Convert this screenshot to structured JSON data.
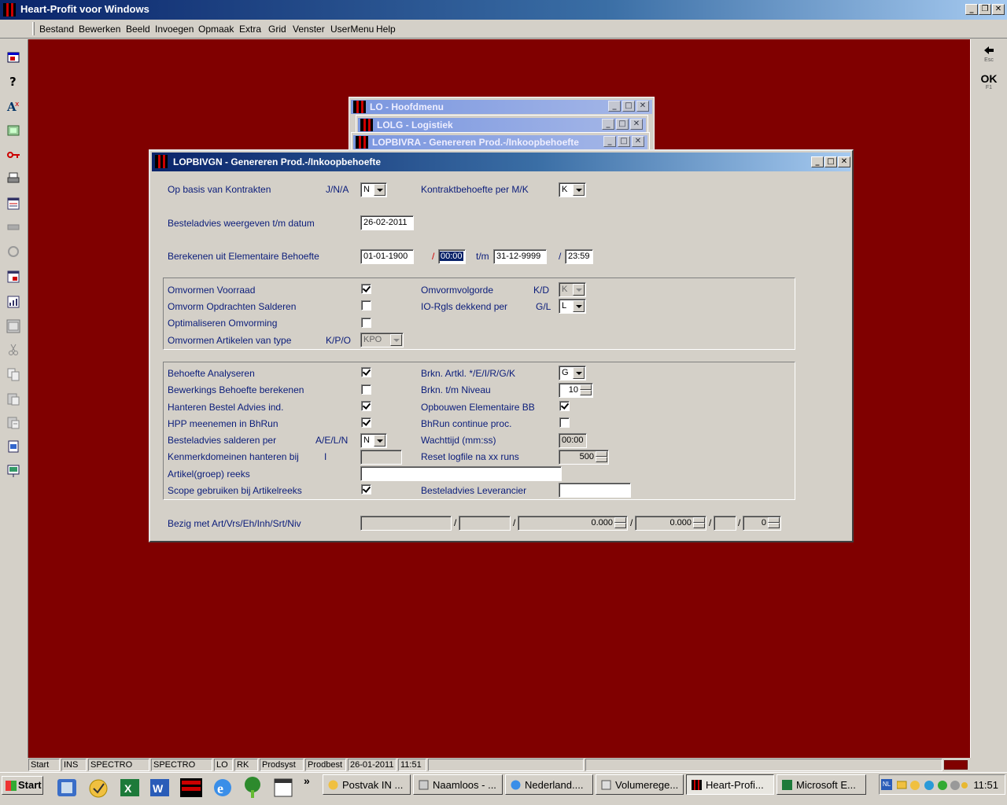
{
  "app": {
    "title": "Heart-Profit voor Windows"
  },
  "menu": [
    "Bestand",
    "Bewerken",
    "Beeld",
    "Invoegen",
    "Opmaak",
    "Extra",
    "Grid",
    "Venster",
    "UserMenu",
    "Help"
  ],
  "right_toolbar": {
    "esc_label": "Esc",
    "ok_label": "OK",
    "f1_label": "F1"
  },
  "background_windows": [
    {
      "title": "LO - Hoofdmenu"
    },
    {
      "title": "LOLG - Logistiek"
    },
    {
      "title": "LOPBIVRA - Genereren Prod.-/Inkoopbehoefte"
    }
  ],
  "dialog": {
    "title": "LOPBIVGN - Genereren Prod.-/Inkoopbehoefte",
    "kontrakten": {
      "label": "Op basis van Kontrakten",
      "hint": "J/N/A",
      "value": "N"
    },
    "kontraktbehoefte": {
      "label": "Kontraktbehoefte per M/K",
      "value": "K"
    },
    "besteladvies_datum": {
      "label": "Besteladvies weergeven t/m datum",
      "value": "26-02-2011"
    },
    "berekenen": {
      "label": "Berekenen uit Elementaire Behoefte",
      "from_date": "01-01-1900",
      "sep1": "/",
      "from_time": "00:00",
      "tm": "t/m",
      "to_date": "31-12-9999",
      "sep2": "/",
      "to_time": "23:59"
    },
    "group1": {
      "omvormen_voorraad": {
        "label": "Omvormen Voorraad",
        "checked": true
      },
      "omvorm_opdrachten": {
        "label": "Omvorm Opdrachten Salderen",
        "checked": false
      },
      "optimaliseren": {
        "label": "Optimaliseren Omvorming",
        "checked": false
      },
      "omvormen_artikelen": {
        "label": "Omvormen Artikelen van type",
        "hint": "K/P/O",
        "value": "KPO"
      },
      "omvormvolgorde": {
        "label": "Omvormvolgorde",
        "hint": "K/D",
        "value": "K"
      },
      "io_rgls": {
        "label": "IO-Rgls dekkend per",
        "hint": "G/L",
        "value": "L"
      }
    },
    "group2": {
      "behoefte_analyseren": {
        "label": "Behoefte Analyseren",
        "checked": true
      },
      "bewerkings_behoefte": {
        "label": "Bewerkings Behoefte berekenen",
        "checked": false
      },
      "hanteren_bestel": {
        "label": "Hanteren Bestel Advies ind.",
        "checked": true
      },
      "hpp_meenemen": {
        "label": "HPP meenemen in BhRun",
        "checked": true
      },
      "besteladvies_salderen": {
        "label": "Besteladvies salderen per",
        "hint": "A/E/L/N",
        "value": "N"
      },
      "kenmerkdomeinen": {
        "label": "Kenmerkdomeinen hanteren bij",
        "hint": "I",
        "value": ""
      },
      "artikel_reeks": {
        "label": "Artikel(groep) reeks",
        "value": ""
      },
      "scope": {
        "label": "Scope gebruiken bij Artikelreeks",
        "checked": true
      },
      "brkn_artkl": {
        "label": "Brkn. Artkl. */E/I/R/G/K",
        "value": "G"
      },
      "brkn_niveau": {
        "label": "Brkn. t/m Niveau",
        "value": "10"
      },
      "opbouwen_bb": {
        "label": "Opbouwen Elementaire BB",
        "checked": true
      },
      "bhrun_continue": {
        "label": "BhRun continue proc.",
        "checked": false
      },
      "wachttijd": {
        "label": "Wachttijd (mm:ss)",
        "value": "00:00"
      },
      "reset_logfile": {
        "label": "Reset logfile na xx runs",
        "value": "500"
      },
      "besteladvies_leverancier": {
        "label": "Besteladvies Leverancier",
        "value": ""
      }
    },
    "bezig": {
      "label": "Bezig met Art/Vrs/Eh/Inh/Srt/Niv",
      "sep": "/",
      "art": "",
      "vrs": "",
      "eh": "0.000",
      "inh": "0.000",
      "srt": "",
      "niv": "0"
    }
  },
  "statusbar": [
    "Start",
    "INS",
    "SPECTRO",
    "SPECTRO",
    "LO",
    "RK",
    "Prodsyst",
    "Prodbest",
    "26-01-2011",
    "11:51"
  ],
  "taskbar": {
    "start_label": "Start",
    "chevron": "»",
    "tasks": [
      {
        "label": "Postvak IN ...",
        "active": false
      },
      {
        "label": "Naamloos - ...",
        "active": false
      },
      {
        "label": "Nederland....",
        "active": false
      },
      {
        "label": "Volumerege...",
        "active": false
      },
      {
        "label": "Heart-Profi...",
        "active": true
      },
      {
        "label": "Microsoft E...",
        "active": false
      }
    ],
    "language": "NL",
    "clock": "11:51"
  }
}
